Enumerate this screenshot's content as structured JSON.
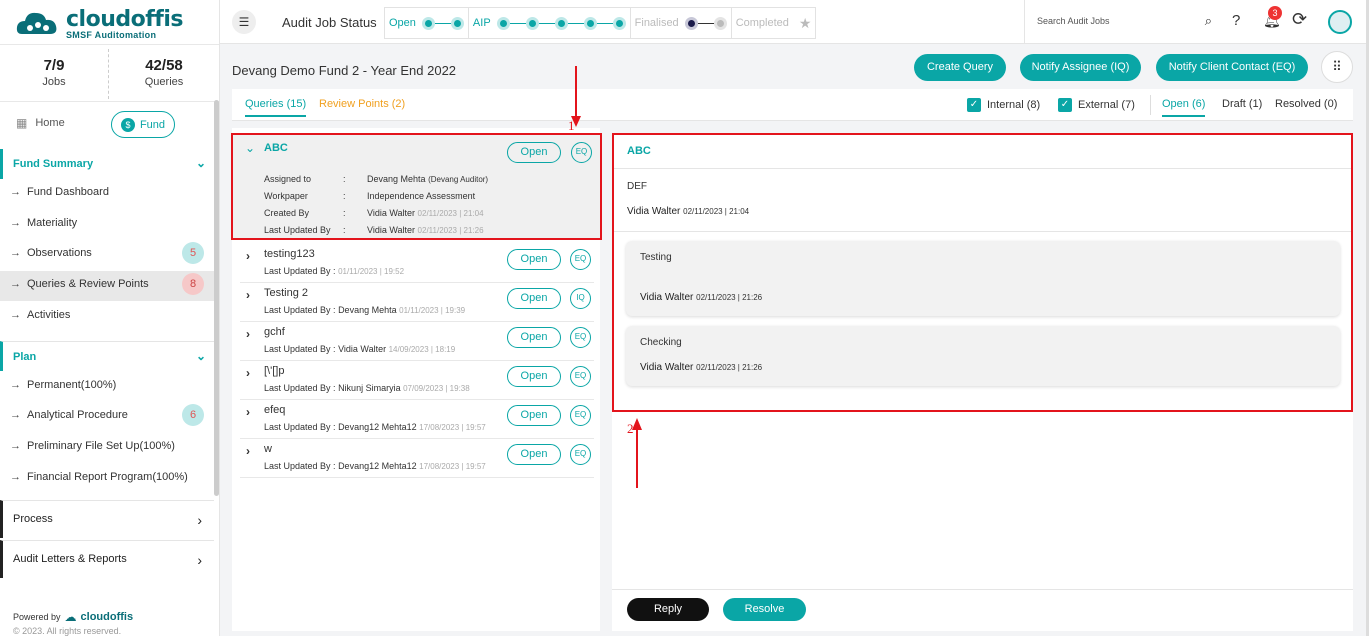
{
  "brand": {
    "name": "cloudoffis",
    "tagline": "SMSF Auditomation"
  },
  "stats": [
    {
      "value": "7/9",
      "label": "Jobs"
    },
    {
      "value": "42/58",
      "label": "Queries"
    }
  ],
  "nav_top": {
    "home": "Home",
    "fund": "Fund"
  },
  "sections": {
    "fund_summary": {
      "title": "Fund Summary",
      "items": [
        {
          "label": "Fund Dashboard",
          "badge": ""
        },
        {
          "label": "Materiality",
          "badge": ""
        },
        {
          "label": "Observations",
          "badge": "5"
        },
        {
          "label": "Queries & Review Points",
          "badge": "8"
        },
        {
          "label": "Activities",
          "badge": ""
        }
      ]
    },
    "plan": {
      "title": "Plan",
      "items": [
        {
          "label": "Permanent(100%)",
          "badge": ""
        },
        {
          "label": "Analytical Procedure",
          "badge": "6"
        },
        {
          "label": "Preliminary File Set Up(100%)",
          "badge": ""
        },
        {
          "label": "Financial Report Program(100%)",
          "badge": ""
        }
      ]
    },
    "process": {
      "title": "Process"
    },
    "audit_letters": {
      "title": "Audit Letters & Reports"
    }
  },
  "footer": {
    "powered_by": "Powered by",
    "logo": "cloudoffis",
    "copyright": "© 2023. All rights reserved."
  },
  "topbar": {
    "title": "Audit Job Status",
    "stages": [
      "Open",
      "AIP",
      "Finalised",
      "Completed"
    ],
    "search_placeholder": "Search Audit Jobs",
    "notification_count": "3"
  },
  "header": {
    "title": "Devang Demo Fund 2 - Year End 2022",
    "buttons": {
      "create_query": "Create Query",
      "notify_assignee": "Notify Assignee (IQ)",
      "notify_client": "Notify Client Contact (EQ)"
    }
  },
  "tabs": {
    "queries": "Queries (15)",
    "review_points": "Review Points (2)"
  },
  "filters": {
    "internal": "Internal (8)",
    "external": "External (7)"
  },
  "status_tabs": {
    "open": "Open (6)",
    "draft": "Draft (1)",
    "resolved": "Resolved (0)"
  },
  "selected_query": {
    "title": "ABC",
    "status": "Open",
    "type": "EQ",
    "details": [
      {
        "label": "Assigned to",
        "value": "Devang Mehta",
        "extra": "(Devang Auditor)",
        "ts": ""
      },
      {
        "label": "Workpaper",
        "value": "Independence Assessment",
        "extra": "",
        "ts": ""
      },
      {
        "label": "Created By",
        "value": "Vidia Walter",
        "extra": "",
        "ts": "02/11/2023 | 21:04"
      },
      {
        "label": "Last Updated By",
        "value": "Vidia Walter",
        "extra": "",
        "ts": "02/11/2023 | 21:26"
      }
    ]
  },
  "queries": [
    {
      "title": "testing123",
      "meta": "Last Updated By :",
      "author": "",
      "ts": "01/11/2023 | 19:52",
      "status": "Open",
      "type": "EQ"
    },
    {
      "title": "Testing 2",
      "meta": "Last Updated By :",
      "author": "Devang Mehta",
      "ts": "01/11/2023 | 19:39",
      "status": "Open",
      "type": "IQ"
    },
    {
      "title": "gchf",
      "meta": "Last Updated By :",
      "author": "Vidia Walter",
      "ts": "14/09/2023 | 18:19",
      "status": "Open",
      "type": "EQ"
    },
    {
      "title": "[\\'[]p",
      "meta": "Last Updated By :",
      "author": "Nikunj Simaryia",
      "ts": "07/09/2023 | 19:38",
      "status": "Open",
      "type": "EQ"
    },
    {
      "title": "efeq",
      "meta": "Last Updated By :",
      "author": "Devang12 Mehta12",
      "ts": "17/08/2023 | 19:57",
      "status": "Open",
      "type": "EQ"
    },
    {
      "title": "w",
      "meta": "Last Updated By :",
      "author": "Devang12 Mehta12",
      "ts": "17/08/2023 | 19:57",
      "status": "Open",
      "type": "EQ"
    }
  ],
  "detail": {
    "title": "ABC",
    "body": "DEF",
    "author": "Vidia Walter",
    "ts": "02/11/2023 | 21:04",
    "replies": [
      {
        "text": "Testing",
        "author": "Vidia Walter",
        "ts": "02/11/2023 | 21:26"
      },
      {
        "text": "Checking",
        "author": "Vidia Walter",
        "ts": "02/11/2023 | 21:26"
      }
    ],
    "reply_button": "Reply",
    "resolve_button": "Resolve"
  },
  "annotations": {
    "one": "1",
    "two": "2"
  },
  "colors": {
    "accent": "#0aa6a6",
    "highlight": "#e3141c",
    "review": "#f0a020"
  }
}
